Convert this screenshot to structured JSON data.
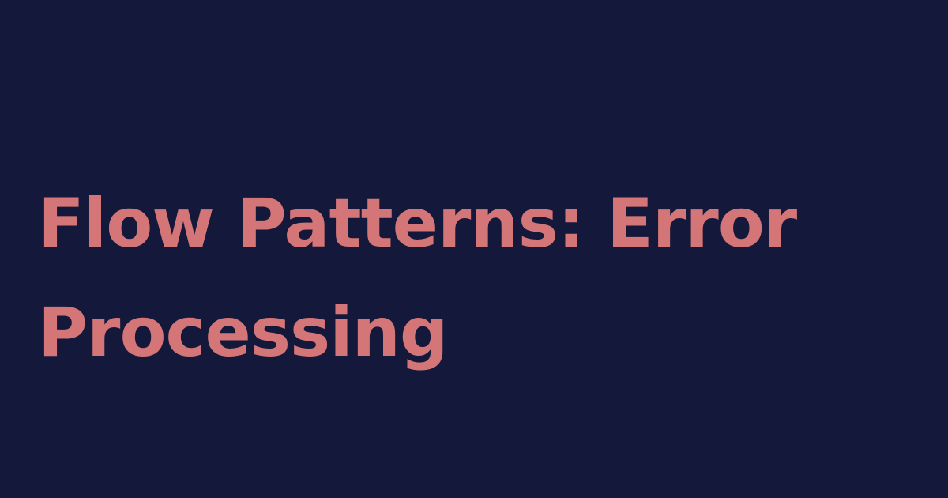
{
  "colors": {
    "background": "#14183a",
    "title": "#d47677"
  },
  "title": {
    "line1": "Flow Patterns: Error",
    "line2": "Processing"
  }
}
